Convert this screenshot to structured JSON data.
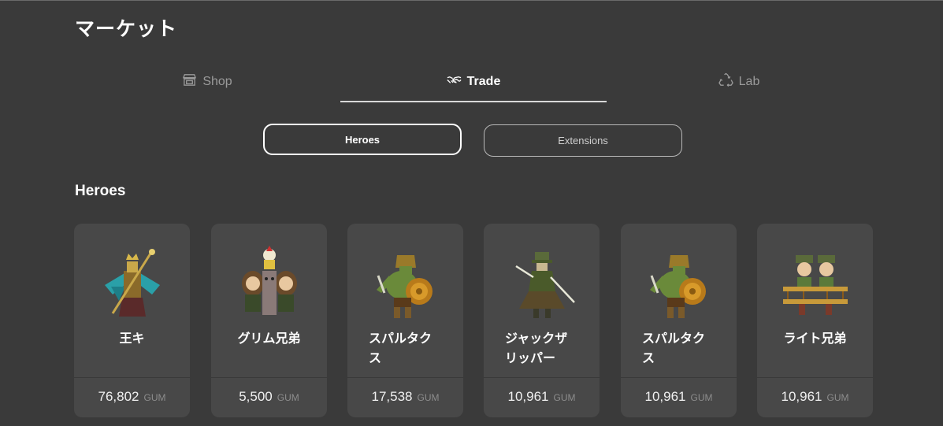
{
  "page": {
    "title": "マーケット"
  },
  "tabs": [
    {
      "label": "Shop",
      "icon": "store-icon",
      "active": false
    },
    {
      "label": "Trade",
      "icon": "handshake-icon",
      "active": true
    },
    {
      "label": "Lab",
      "icon": "recycle-icon",
      "active": false
    }
  ],
  "subtabs": [
    {
      "label": "Heroes",
      "active": true
    },
    {
      "label": "Extensions",
      "active": false
    }
  ],
  "section": {
    "title": "Heroes"
  },
  "heroes": [
    {
      "name": "王キ",
      "price": "76,802",
      "currency": "GUM",
      "art": "king-hero-art"
    },
    {
      "name": "グリム兄弟",
      "price": "5,500",
      "currency": "GUM",
      "art": "grimm-brothers-art"
    },
    {
      "name": "スパルタクス",
      "price": "17,538",
      "currency": "GUM",
      "art": "spartacus-art"
    },
    {
      "name": "ジャックザリッパー",
      "price": "10,961",
      "currency": "GUM",
      "art": "jack-the-ripper-art"
    },
    {
      "name": "スパルタクス",
      "price": "10,961",
      "currency": "GUM",
      "art": "spartacus-art"
    },
    {
      "name": "ライト兄弟",
      "price": "10,961",
      "currency": "GUM",
      "art": "wright-brothers-art"
    }
  ],
  "colors": {
    "background": "#3a3a3a",
    "card": "#484848",
    "accent": "#ffffff",
    "muted": "#9a9a9a"
  }
}
